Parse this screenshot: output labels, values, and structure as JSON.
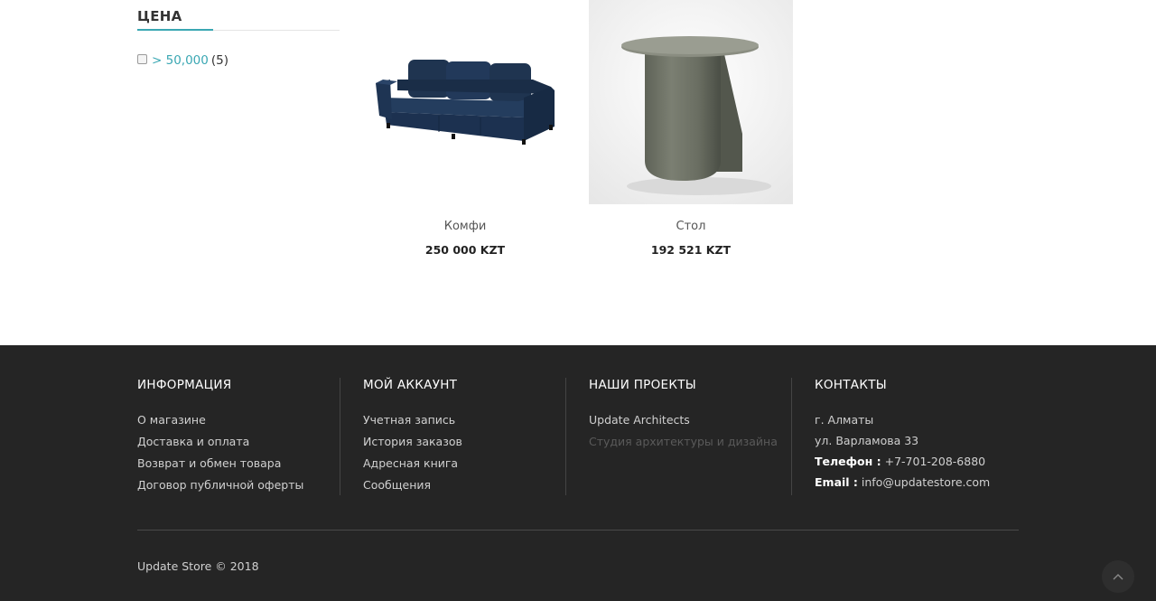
{
  "filter": {
    "title": "ЦЕНА",
    "options": [
      {
        "label": "> 50,000",
        "count": "(5)"
      }
    ]
  },
  "products": [
    {
      "name": "Комфи",
      "price": "250 000 KZT",
      "image_icon": "sofa-image"
    },
    {
      "name": "Стол",
      "price": "192 521 KZT",
      "image_icon": "side-table-image"
    }
  ],
  "footer": {
    "info": {
      "title": "ИНФОРМАЦИЯ",
      "links": [
        "О магазине",
        "Доставка и оплата",
        "Возврат и обмен товара",
        "Договор публичной оферты"
      ]
    },
    "account": {
      "title": "МОЙ АККАУНТ",
      "links": [
        "Учетная запись",
        "История заказов",
        "Адресная книга",
        "Сообщения"
      ]
    },
    "projects": {
      "title": "НАШИ ПРОЕКТЫ",
      "items": [
        "Update Architects",
        "Студия архитектуры и дизайна"
      ]
    },
    "contacts": {
      "title": "КОНТАКТЫ",
      "city": "г. Алматы",
      "street": "ул. Варламова 33",
      "phone_label": "Телефон :",
      "phone": "+7-701-208-6880",
      "email_label": "Email :",
      "email": "info@updatestore.com"
    },
    "copyright": "Update Store © 2018"
  },
  "colors": {
    "accent": "#3aa7b3",
    "footer_bg": "#252525"
  }
}
